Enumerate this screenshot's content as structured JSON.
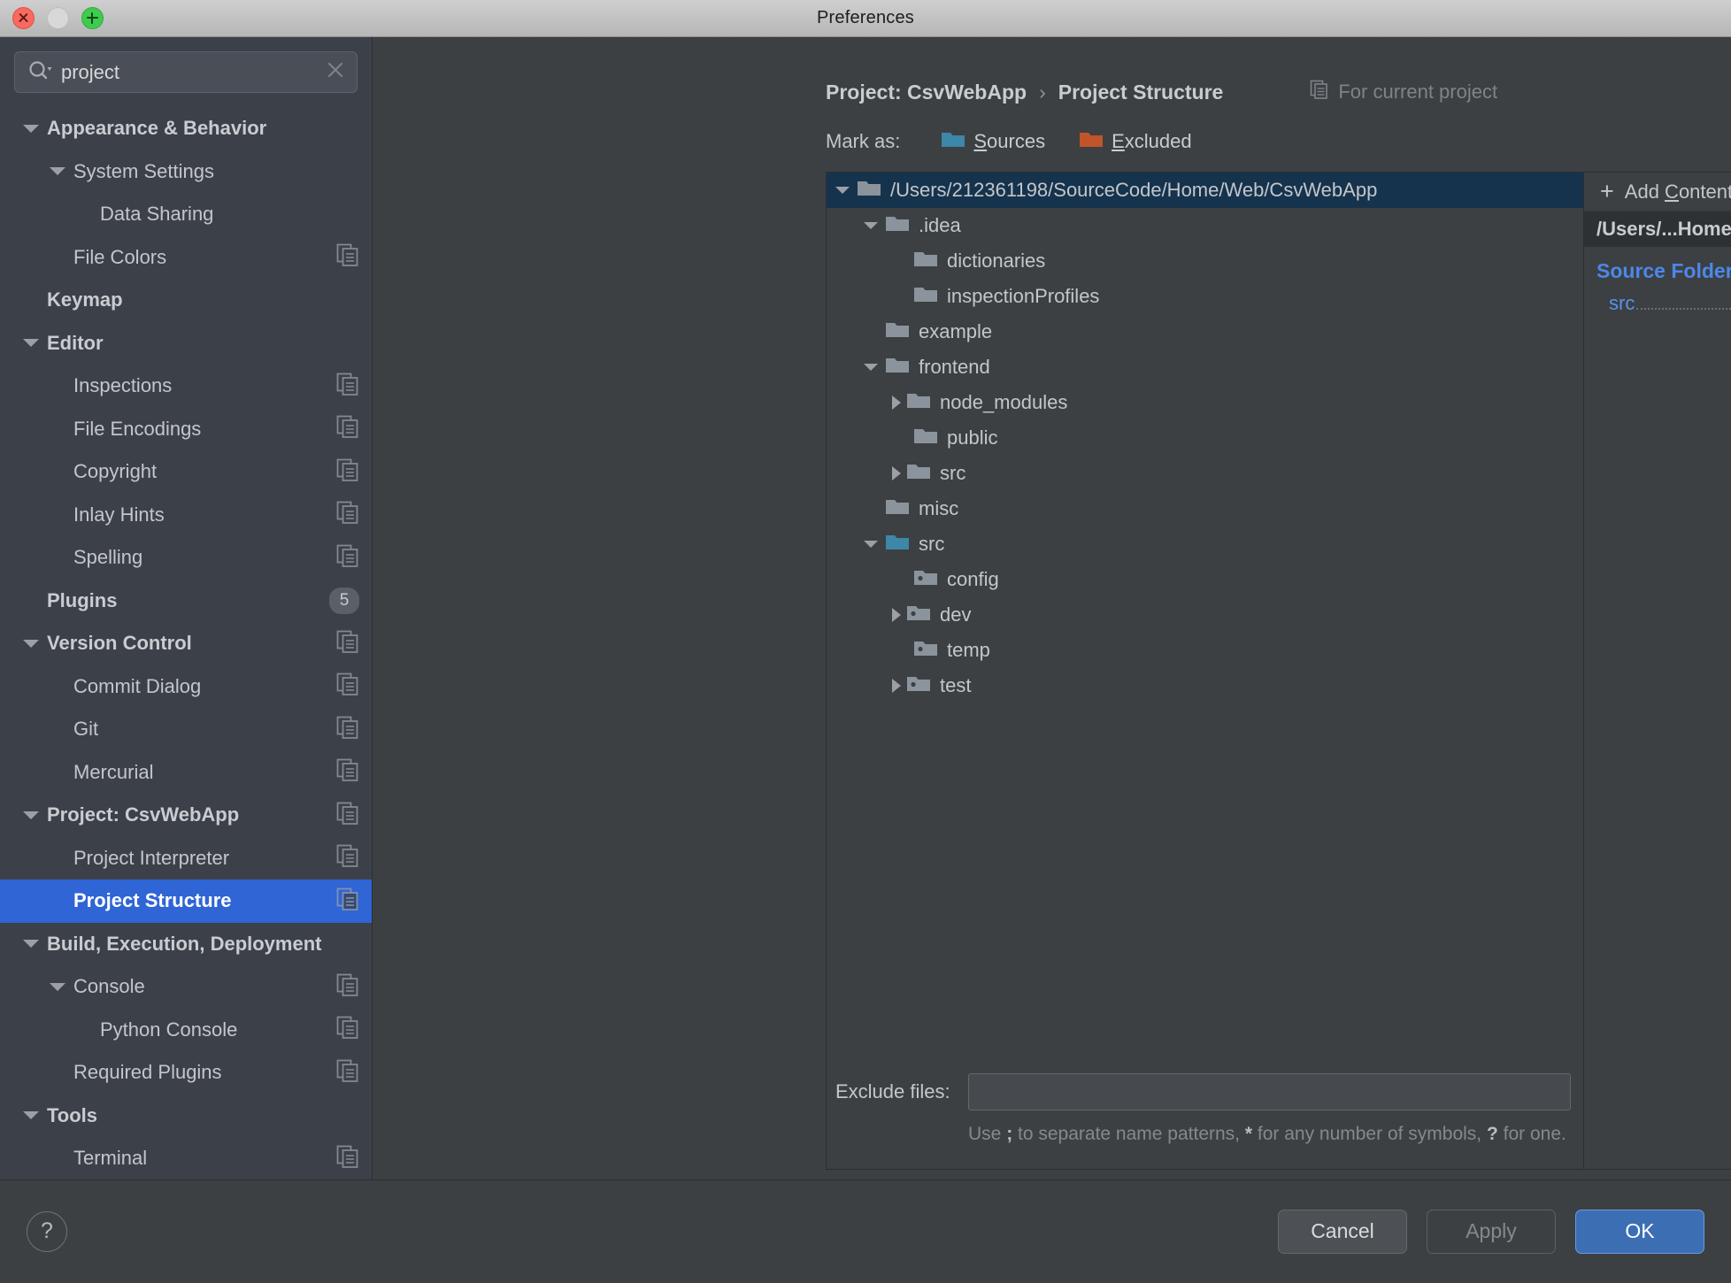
{
  "window": {
    "title": "Preferences"
  },
  "traffic": {
    "close": "close-window",
    "minimize": "minimize-window",
    "zoom": "zoom-window"
  },
  "search": {
    "value": "project",
    "placeholder": ""
  },
  "sidebar": {
    "items": [
      {
        "label": "Appearance & Behavior",
        "indent": 0,
        "caret": "down",
        "bold": true,
        "icon": "none",
        "selected": false
      },
      {
        "label": "System Settings",
        "indent": 1,
        "caret": "down",
        "bold": false,
        "icon": "none",
        "selected": false
      },
      {
        "label": "Data Sharing",
        "indent": 2,
        "caret": "none",
        "bold": false,
        "icon": "none",
        "selected": false
      },
      {
        "label": "File Colors",
        "indent": 1,
        "caret": "none",
        "bold": false,
        "icon": "copy",
        "selected": false
      },
      {
        "label": "Keymap",
        "indent": 0,
        "caret": "none",
        "bold": true,
        "icon": "none",
        "selected": false
      },
      {
        "label": "Editor",
        "indent": 0,
        "caret": "down",
        "bold": true,
        "icon": "none",
        "selected": false
      },
      {
        "label": "Inspections",
        "indent": 1,
        "caret": "none",
        "bold": false,
        "icon": "copy",
        "selected": false
      },
      {
        "label": "File Encodings",
        "indent": 1,
        "caret": "none",
        "bold": false,
        "icon": "copy",
        "selected": false
      },
      {
        "label": "Copyright",
        "indent": 1,
        "caret": "none",
        "bold": false,
        "icon": "copy",
        "selected": false
      },
      {
        "label": "Inlay Hints",
        "indent": 1,
        "caret": "none",
        "bold": false,
        "icon": "copy",
        "selected": false
      },
      {
        "label": "Spelling",
        "indent": 1,
        "caret": "none",
        "bold": false,
        "icon": "copy",
        "selected": false
      },
      {
        "label": "Plugins",
        "indent": 0,
        "caret": "none",
        "bold": true,
        "icon": "badge",
        "badge": "5",
        "selected": false
      },
      {
        "label": "Version Control",
        "indent": 0,
        "caret": "down",
        "bold": true,
        "icon": "copy",
        "selected": false
      },
      {
        "label": "Commit Dialog",
        "indent": 1,
        "caret": "none",
        "bold": false,
        "icon": "copy",
        "selected": false
      },
      {
        "label": "Git",
        "indent": 1,
        "caret": "none",
        "bold": false,
        "icon": "copy",
        "selected": false
      },
      {
        "label": "Mercurial",
        "indent": 1,
        "caret": "none",
        "bold": false,
        "icon": "copy",
        "selected": false
      },
      {
        "label": "Project: CsvWebApp",
        "indent": 0,
        "caret": "down",
        "bold": true,
        "icon": "copy",
        "selected": false
      },
      {
        "label": "Project Interpreter",
        "indent": 1,
        "caret": "none",
        "bold": false,
        "icon": "copy",
        "selected": false
      },
      {
        "label": "Project Structure",
        "indent": 1,
        "caret": "none",
        "bold": false,
        "icon": "copy",
        "selected": true
      },
      {
        "label": "Build, Execution, Deployment",
        "indent": 0,
        "caret": "down",
        "bold": true,
        "icon": "none",
        "selected": false
      },
      {
        "label": "Console",
        "indent": 1,
        "caret": "down",
        "bold": false,
        "icon": "copy",
        "selected": false
      },
      {
        "label": "Python Console",
        "indent": 2,
        "caret": "none",
        "bold": false,
        "icon": "copy",
        "selected": false
      },
      {
        "label": "Required Plugins",
        "indent": 1,
        "caret": "none",
        "bold": false,
        "icon": "copy",
        "selected": false
      },
      {
        "label": "Tools",
        "indent": 0,
        "caret": "down",
        "bold": true,
        "icon": "none",
        "selected": false
      },
      {
        "label": "Terminal",
        "indent": 1,
        "caret": "none",
        "bold": false,
        "icon": "copy",
        "selected": false
      }
    ]
  },
  "breadcrumb": {
    "project": "Project: CsvWebApp",
    "separator": "›",
    "page": "Project Structure",
    "for_current_project": "For current project"
  },
  "mark_as": {
    "label": "Mark as:",
    "sources": {
      "prefix": "S",
      "rest": "ources",
      "color": "#3d87a8"
    },
    "excluded": {
      "prefix": "E",
      "rest": "xcluded",
      "color": "#c1542a"
    }
  },
  "file_tree": {
    "rows": [
      {
        "name": "/Users/212361198/SourceCode/Home/Web/CsvWebApp",
        "indent": 0,
        "caret": "down",
        "icon": "folder",
        "selected": true
      },
      {
        "name": ".idea",
        "indent": 1,
        "caret": "down",
        "icon": "folder",
        "selected": false
      },
      {
        "name": "dictionaries",
        "indent": 2,
        "caret": "none",
        "icon": "folder",
        "selected": false
      },
      {
        "name": "inspectionProfiles",
        "indent": 2,
        "caret": "none",
        "icon": "folder",
        "selected": false
      },
      {
        "name": "example",
        "indent": 1,
        "caret": "none",
        "icon": "folder",
        "selected": false
      },
      {
        "name": "frontend",
        "indent": 1,
        "caret": "down",
        "icon": "folder",
        "selected": false
      },
      {
        "name": "node_modules",
        "indent": 2,
        "caret": "right",
        "icon": "folder",
        "selected": false
      },
      {
        "name": "public",
        "indent": 2,
        "caret": "none",
        "icon": "folder",
        "selected": false
      },
      {
        "name": "src",
        "indent": 2,
        "caret": "right",
        "icon": "folder",
        "selected": false
      },
      {
        "name": "misc",
        "indent": 1,
        "caret": "none",
        "icon": "folder",
        "selected": false
      },
      {
        "name": "src",
        "indent": 1,
        "caret": "down",
        "icon": "source",
        "selected": false
      },
      {
        "name": "config",
        "indent": 2,
        "caret": "none",
        "icon": "package",
        "selected": false
      },
      {
        "name": "dev",
        "indent": 2,
        "caret": "right",
        "icon": "package",
        "selected": false
      },
      {
        "name": "temp",
        "indent": 2,
        "caret": "none",
        "icon": "package",
        "selected": false
      },
      {
        "name": "test",
        "indent": 2,
        "caret": "right",
        "icon": "package",
        "selected": false
      }
    ]
  },
  "exclude": {
    "label": "Exclude files:",
    "value": "",
    "placeholder": "",
    "hint_parts": [
      "Use ",
      ";",
      " to separate name patterns, ",
      "*",
      " for any number of symbols, ",
      "?",
      " for one."
    ]
  },
  "right_panel": {
    "add_content_root": {
      "plus": "+",
      "prefix": "Add ",
      "mnemonic": "C",
      "rest": "ontent Root"
    },
    "content_root": {
      "path": "/Users/...Home/Web/CsvWebApp",
      "remove": "×"
    },
    "source_folders_title": "Source Folders",
    "source_folders": [
      {
        "name": "src",
        "remove": "×"
      }
    ]
  },
  "footer": {
    "help": "?",
    "cancel": "Cancel",
    "apply": "Apply",
    "ok": "OK"
  },
  "colors": {
    "accent_blue": "#2f65d4",
    "ok_blue": "#3c6eb4",
    "source_teal": "#3d87a8",
    "excluded_orange": "#c1542a",
    "link_blue": "#4d87e8",
    "selected_tree": "#16334d"
  }
}
